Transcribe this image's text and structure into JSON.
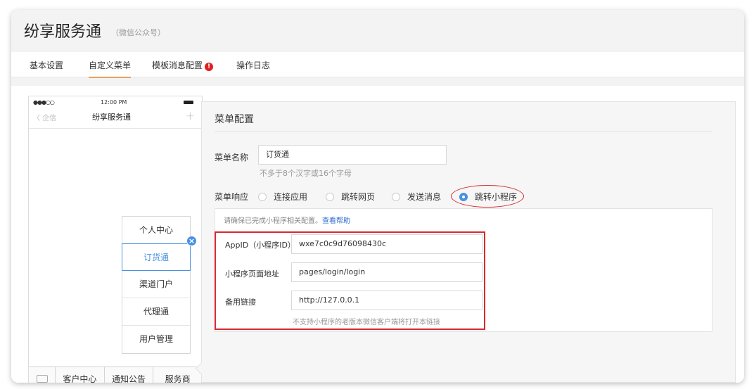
{
  "app": {
    "title": "纷享服务通",
    "subtitle": "（微信公众号）"
  },
  "tabs": [
    {
      "label": "基本设置",
      "active": false
    },
    {
      "label": "自定义菜单",
      "active": true
    },
    {
      "label": "模板消息配置",
      "active": false,
      "badge": "!"
    },
    {
      "label": "操作日志",
      "active": false
    }
  ],
  "phone": {
    "signal": "●●●○○",
    "time": "12:00 PM",
    "back": "〈 企信",
    "nav_title": "纷享服务通",
    "plus": "+",
    "submenu": [
      "个人中心",
      "订货通",
      "渠道门户",
      "代理通",
      "用户管理"
    ],
    "selected_submenu": "订货通",
    "menubar": [
      "客户中心",
      "通知公告",
      "服务商"
    ]
  },
  "config": {
    "title": "菜单配置",
    "name_label": "菜单名称",
    "name_value": "订货通",
    "name_hint": "不多于8个汉字或16个字母",
    "response_label": "菜单响应",
    "response_options": [
      "连接应用",
      "跳转网页",
      "发送消息",
      "跳转小程序"
    ],
    "response_selected": "跳转小程序",
    "tip_text": "请确保已完成小程序相关配置。",
    "tip_link": "查看帮助",
    "appid_label": "AppID（小程序ID）",
    "appid_value": "wxe7c0c9d76098430c",
    "page_label": "小程序页面地址",
    "page_value": "pages/login/login",
    "backup_label": "备用链接",
    "backup_value": "http://127.0.0.1",
    "backup_hint": "不支持小程序的老版本微信客户端将打开本链接"
  },
  "colors": {
    "accent": "#4a90e2",
    "tab_underline": "#e7a25a",
    "annotation_red": "#d8292e",
    "badge_red": "#e02020"
  }
}
